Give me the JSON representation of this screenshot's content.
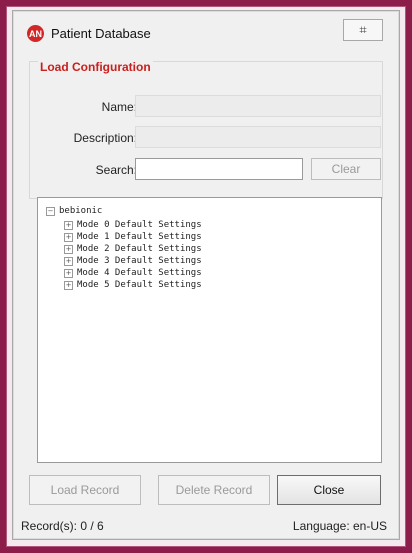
{
  "window": {
    "title": "Patient Database",
    "close_glyph": "⌗",
    "app_icon_text": "AN"
  },
  "group": {
    "title": "Load Configuration"
  },
  "fields": {
    "name_label": "Name:",
    "description_label": "Description:",
    "search_label": "Search:",
    "name_value": "",
    "description_value": "",
    "search_value": ""
  },
  "buttons": {
    "clear": "Clear",
    "load": "Load Record",
    "delete": "Delete Record",
    "close": "Close"
  },
  "tree": {
    "root": "bebionic",
    "children": [
      "Mode 0 Default Settings",
      "Mode 1 Default Settings",
      "Mode 2 Default Settings",
      "Mode 3 Default Settings",
      "Mode 4 Default Settings",
      "Mode 5 Default Settings"
    ]
  },
  "status": {
    "records": "Record(s): 0 / 6",
    "language": "Language: en-US"
  },
  "colors": {
    "accent": "#c8201e",
    "background": "#8c1d4a"
  }
}
